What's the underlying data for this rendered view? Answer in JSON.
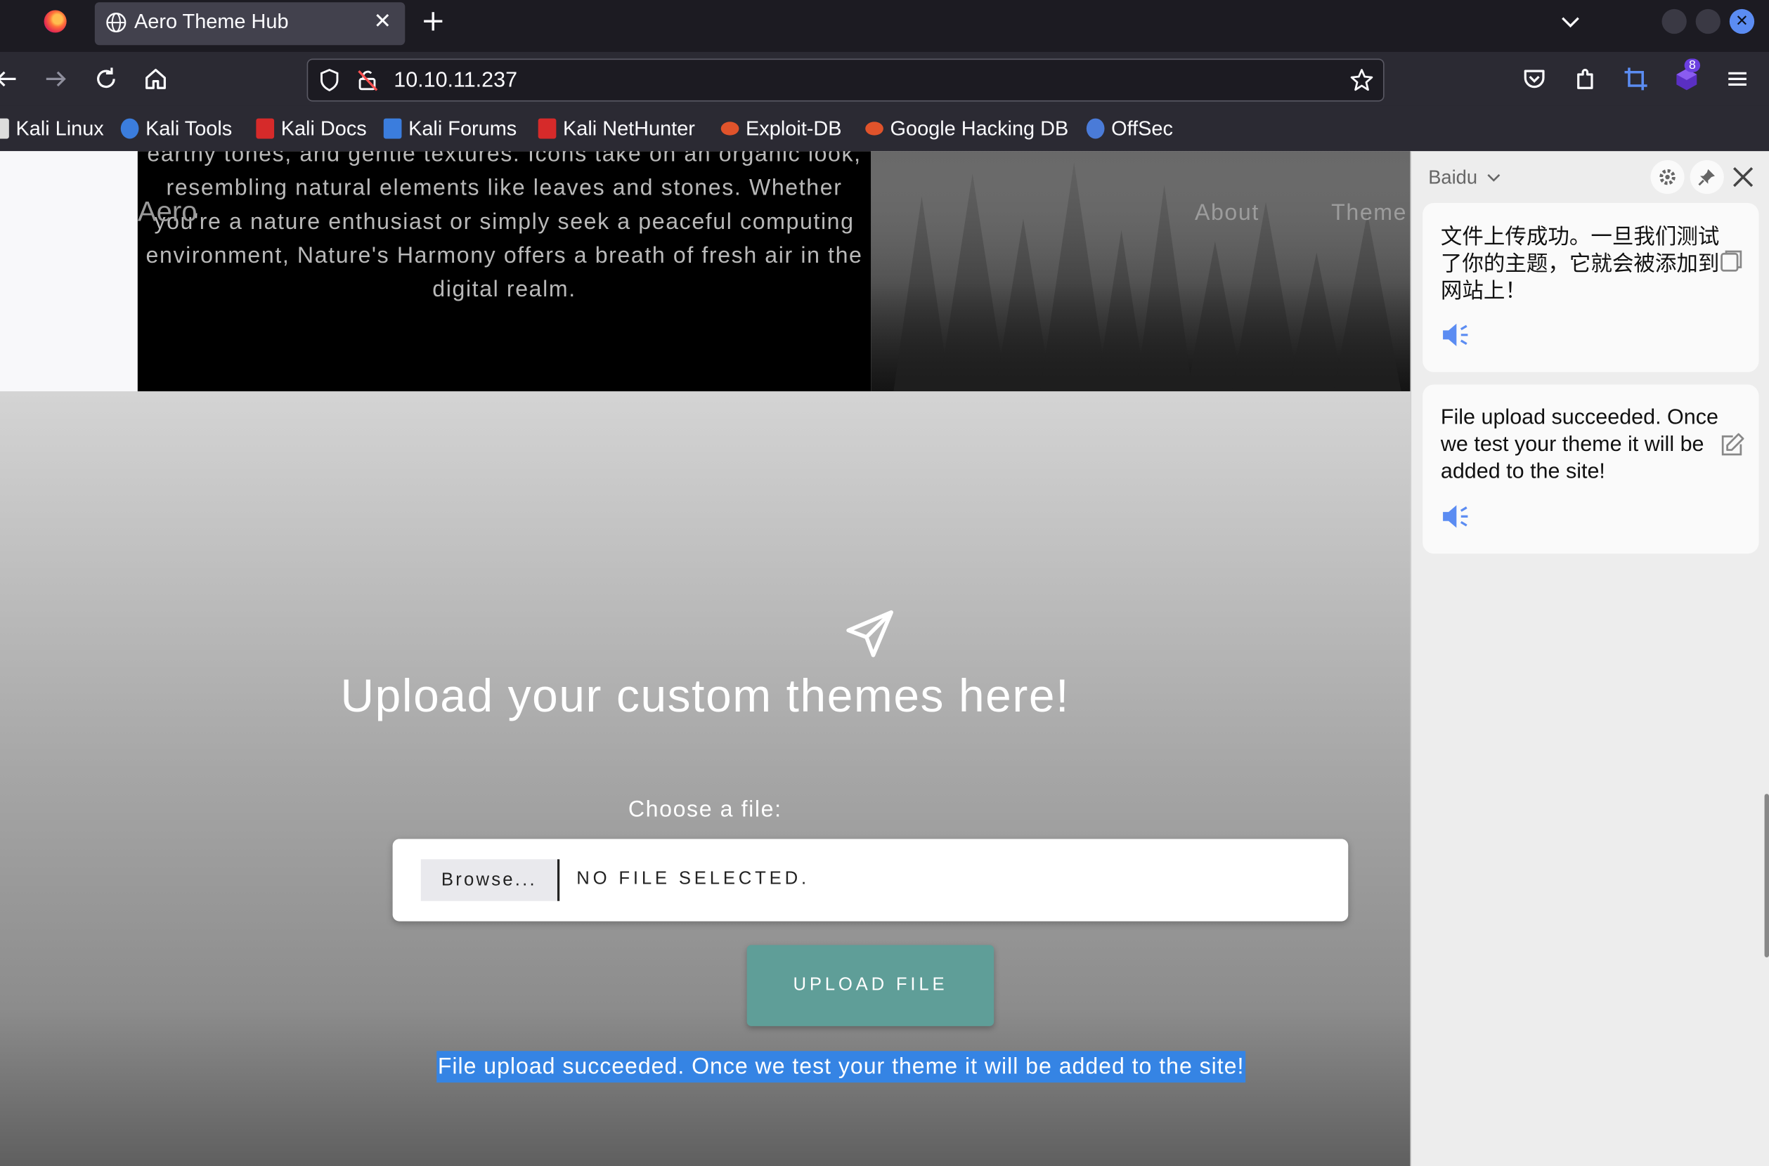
{
  "browser": {
    "tab_title": "Aero Theme Hub",
    "tab_close": "✕",
    "new_tab": "+",
    "url": "10.10.11.237",
    "extension_badge": "8",
    "window_close": "✕"
  },
  "bookmarks": [
    {
      "label": "Kali Linux",
      "color": "#dddddd"
    },
    {
      "label": "Kali Tools",
      "color": "#3b7ddd"
    },
    {
      "label": "Kali Docs",
      "color": "#d62a2a"
    },
    {
      "label": "Kali Forums",
      "color": "#3b7ddd"
    },
    {
      "label": "Kali NetHunter",
      "color": "#d62a2a"
    },
    {
      "label": "Exploit-DB",
      "color": "#e0532b"
    },
    {
      "label": "Google Hacking DB",
      "color": "#e0532b"
    },
    {
      "label": "OffSec",
      "color": "#4a7bd8"
    }
  ],
  "page": {
    "hero_text": "earthy tones, and gentle textures. Icons take on an organic look, resembling natural elements like leaves and stones. Whether you're a nature enthusiast or simply seek a peaceful computing environment, Nature's Harmony offers a breath of fresh air in the digital realm.",
    "logo": "Aero",
    "nav": [
      "About",
      "Theme"
    ],
    "upload_title": "Upload your custom themes here!",
    "choose_label": "Choose a file:",
    "browse_label": "Browse...",
    "no_file": "NO FILE SELECTED.",
    "upload_button": "UPLOAD FILE",
    "success_message": "File upload succeeded. Once we test your theme it will be added to the site!"
  },
  "translator": {
    "provider": "Baidu",
    "source_text": "文件上传成功。一旦我们测试了你的主题，它就会被添加到网站上！",
    "translation": "File upload succeeded. Once we test your theme it will be added to the site!"
  },
  "colors": {
    "upload_button": "#5f9e98",
    "selection": "#3584e4",
    "accent": "#5b8cf2"
  }
}
